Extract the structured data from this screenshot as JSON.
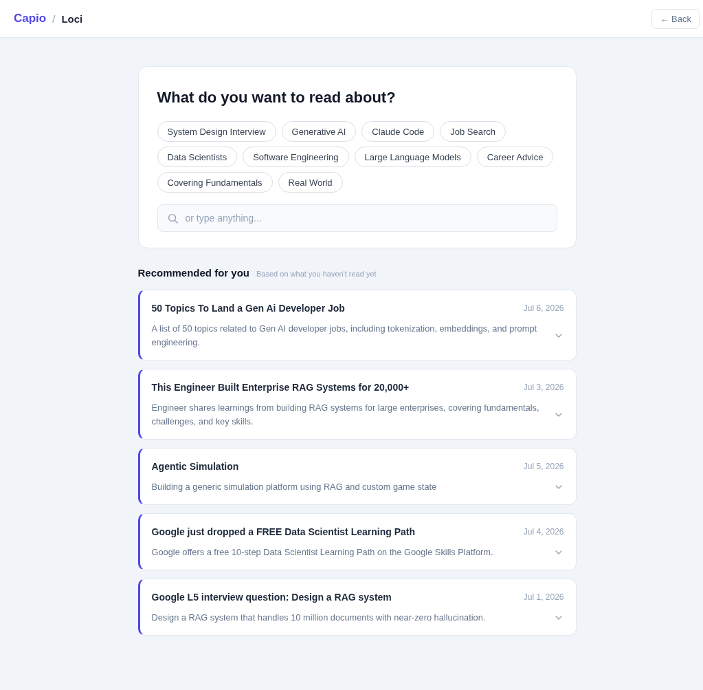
{
  "header": {
    "brand": "Capio",
    "separator": "/",
    "page": "Loci",
    "back_button": "← Back"
  },
  "prompt": {
    "title": "What do you want to read about?",
    "topics": [
      "System Design Interview",
      "Generative AI",
      "Claude Code",
      "Job Search",
      "Data Scientists",
      "Software Engineering",
      "Large Language Models",
      "Career Advice",
      "Covering Fundamentals",
      "Real World"
    ],
    "search": {
      "placeholder": "or type anything..."
    }
  },
  "recommended": {
    "title": "Recommended for you",
    "subtitle": "Based on what you haven't read yet",
    "articles": [
      {
        "title": "50 Topics To Land a Gen Ai Developer Job",
        "date": "Jul 6, 2026",
        "summary": "A list of 50 topics related to Gen AI developer jobs, including tokenization, embeddings, and prompt engineering."
      },
      {
        "title": "This Engineer Built Enterprise RAG Systems for 20,000+",
        "date": "Jul 3, 2026",
        "summary": "Engineer shares learnings from building RAG systems for large enterprises, covering fundamentals, challenges, and key skills."
      },
      {
        "title": "Agentic Simulation",
        "date": "Jul 5, 2026",
        "summary": "Building a generic simulation platform using RAG and custom game state"
      },
      {
        "title": "Google just dropped a FREE Data Scientist Learning Path",
        "date": "Jul 4, 2026",
        "summary": "Google offers a free 10-step Data Scientist Learning Path on the Google Skills Platform."
      },
      {
        "title": "Google L5 interview question: Design a RAG system",
        "date": "Jul 1, 2026",
        "summary": "Design a RAG system that handles 10 million documents with near-zero hallucination."
      }
    ]
  }
}
